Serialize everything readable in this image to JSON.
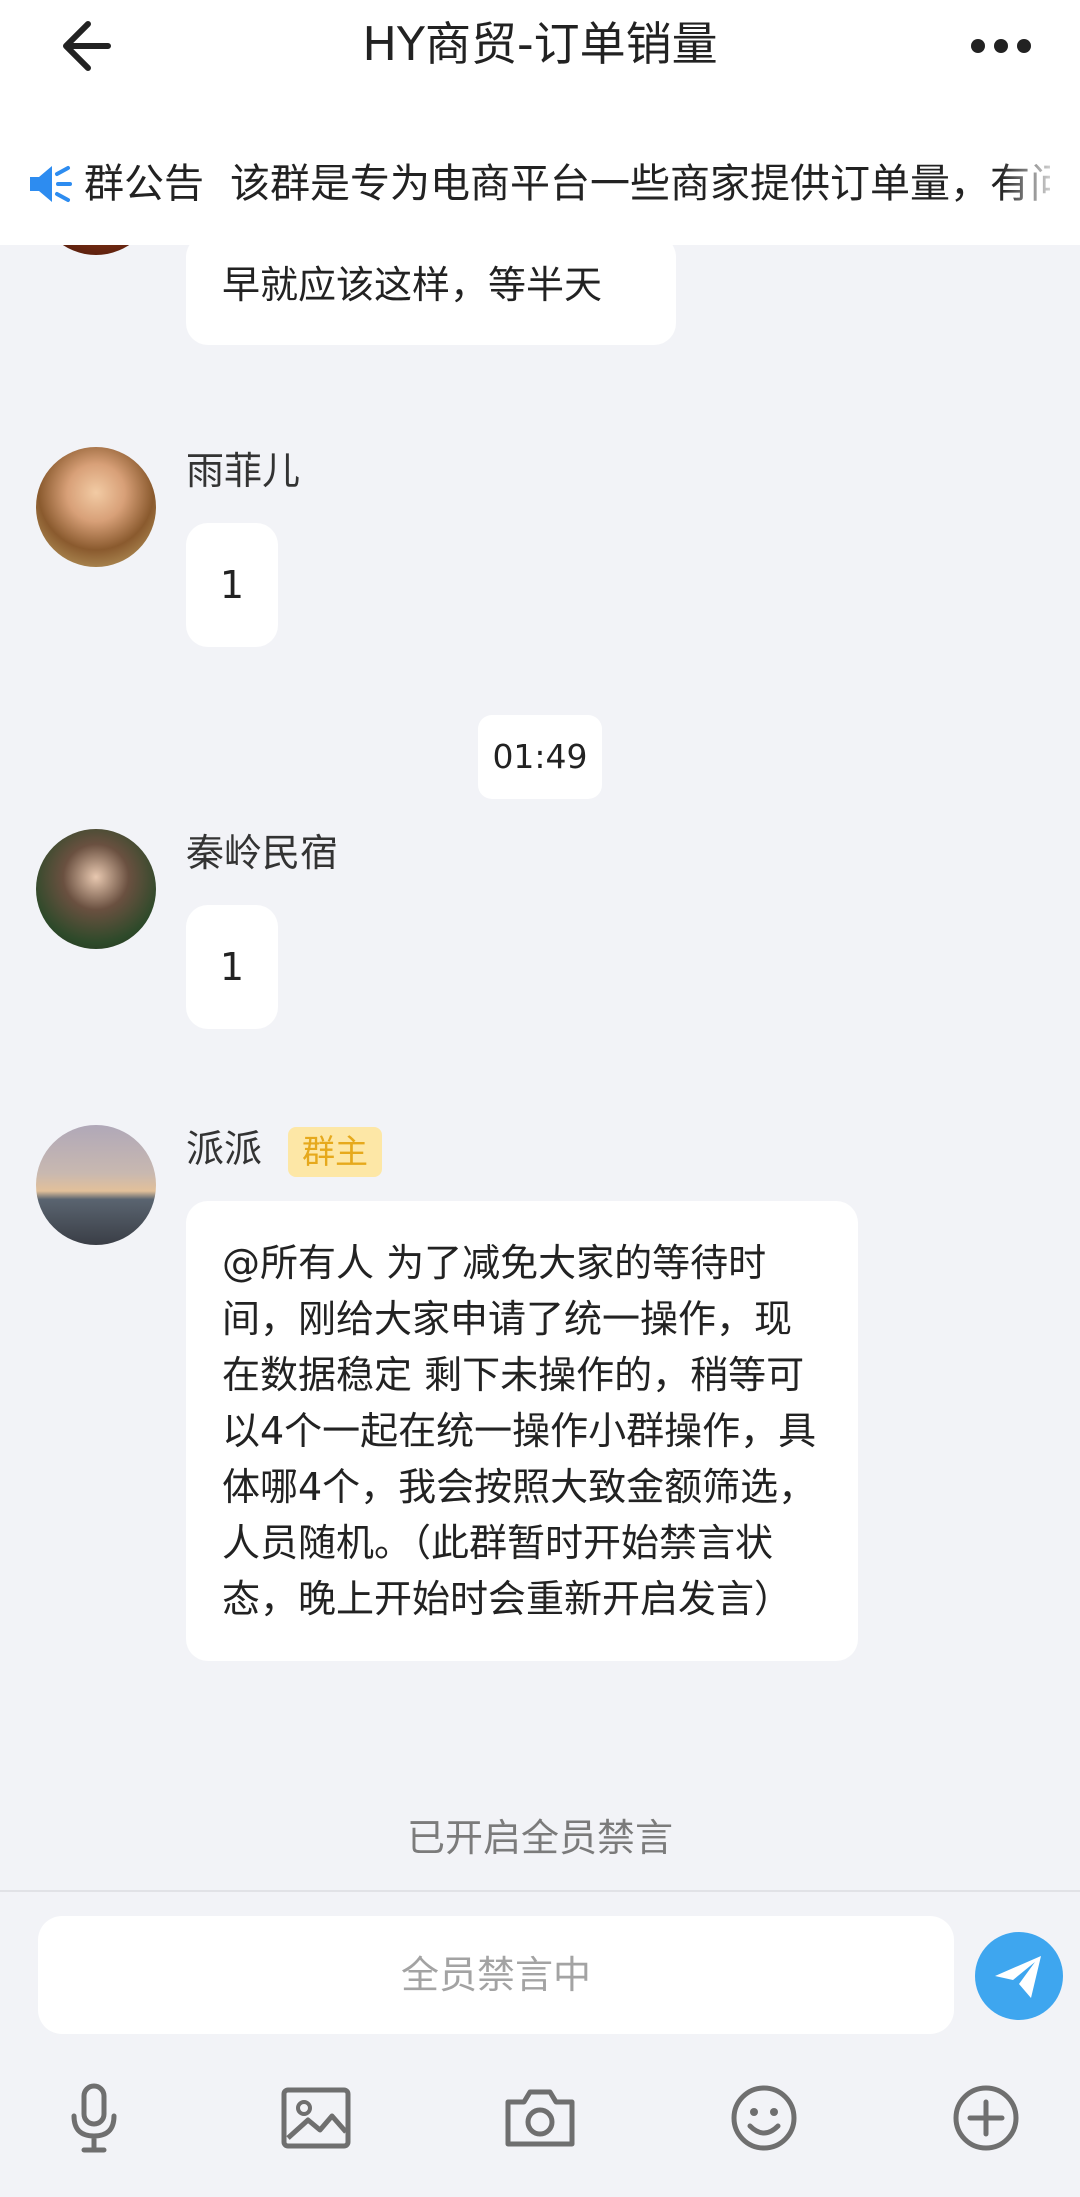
{
  "header": {
    "title": "HY商贸-订单销量",
    "back_icon": "arrow-left-icon",
    "more_icon": "more-dots-icon"
  },
  "notice": {
    "icon": "speaker-icon",
    "label": "群公告",
    "text": "该群是专为电商平台一些商家提供订单量，有问"
  },
  "messages": [
    {
      "sender": "",
      "text": "早就应该这样，等半天"
    },
    {
      "sender": "雨菲儿",
      "text": "1"
    },
    {
      "sender": "秦岭民宿",
      "text": "1"
    },
    {
      "sender": "派派",
      "badge": "群主",
      "text": "@所有人  为了减免大家的等待时间，刚给大家申请了统一操作，现在数据稳定 剩下未操作的，稍等可以4个一起在统一操作小群操作，具体哪4个，我会按照大致金额筛选，人员随机。（此群暂时开始禁言状态，晚上开始时会重新开启发言）"
    }
  ],
  "timestamp": "01:49",
  "system_note": "已开启全员禁言",
  "input": {
    "placeholder": "全员禁言中"
  },
  "colors": {
    "accent": "#3ea6ef",
    "badge_bg": "#fde7a6",
    "badge_text": "#e6a91c",
    "background": "#f2f3f7"
  },
  "toolbar": [
    "microphone-icon",
    "image-icon",
    "camera-icon",
    "emoji-icon",
    "plus-circle-icon"
  ]
}
